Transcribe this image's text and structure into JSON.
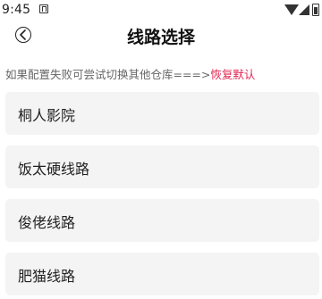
{
  "status_bar": {
    "time": "9:45"
  },
  "header": {
    "title": "线路选择",
    "back_icon": "back-circle-arrow"
  },
  "hint": {
    "text": "如果配置失败可尝试切换其他仓库===>",
    "restore_label": "恢复默认",
    "restore_color": "#e0234e"
  },
  "routes": [
    {
      "label": "桐人影院"
    },
    {
      "label": "饭太硬线路"
    },
    {
      "label": "俊佬线路"
    },
    {
      "label": "肥猫线路"
    }
  ]
}
